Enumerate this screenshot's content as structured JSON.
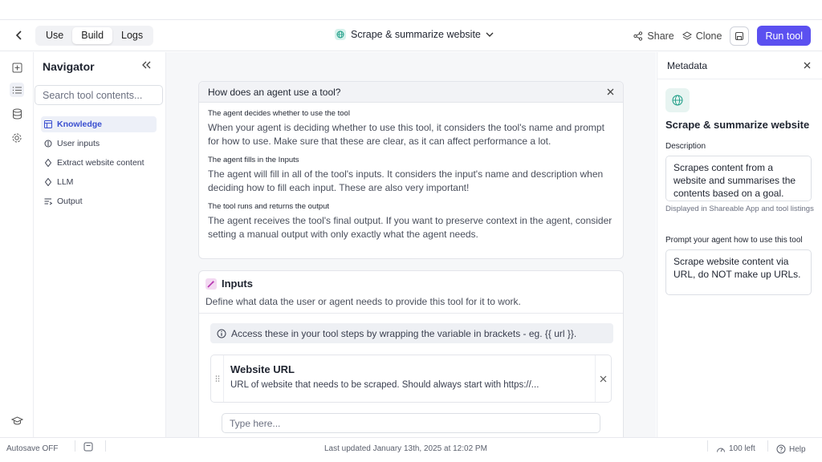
{
  "topbar": {
    "modes": [
      "Use",
      "Build",
      "Logs"
    ],
    "active_mode": "Build",
    "tool_title": "Scrape & summarize website",
    "share_label": "Share",
    "clone_label": "Clone",
    "run_label": "Run tool"
  },
  "navigator": {
    "title": "Navigator",
    "search_placeholder": "Search tool contents...",
    "items": [
      {
        "label": "Knowledge",
        "icon": "table-icon"
      },
      {
        "label": "User inputs",
        "icon": "input-icon"
      },
      {
        "label": "Extract website content",
        "icon": "diamond-icon"
      },
      {
        "label": "LLM",
        "icon": "diamond-icon"
      },
      {
        "label": "Output",
        "icon": "output-icon"
      }
    ]
  },
  "help": {
    "title": "How does an agent use a tool?",
    "sections": [
      {
        "heading": "The agent decides whether to use the tool",
        "text": "When your agent is deciding whether to use this tool, it considers the tool's name and prompt for how to use. Make sure that these are clear, as it can affect performance a lot."
      },
      {
        "heading": "The agent fills in the Inputs",
        "text": "The agent will fill in all of the tool's inputs. It considers the input's name and description when deciding how to fill each input. These are also very important!"
      },
      {
        "heading": "The tool runs and returns the output",
        "text": "The agent receives the tool's final output. If you want to preserve context in the agent, consider setting a manual output with only exactly what the agent needs."
      }
    ]
  },
  "inputs": {
    "title": "Inputs",
    "description": "Define what data the user or agent needs to provide this tool for it to work.",
    "info": "Access these in your tool steps by wrapping the variable in brackets - eg. {{ url }}.",
    "field": {
      "title": "Website URL",
      "description": "URL of website that needs to be scraped. Should always start with https://...",
      "placeholder": "Type here..."
    }
  },
  "metadata": {
    "title": "Metadata",
    "tool_name": "Scrape & summarize website",
    "description_label": "Description",
    "description_value": "Scrapes content from a website and summarises the contents based on a goal.",
    "description_hint": "Displayed in Shareable App and tool listings",
    "prompt_label": "Prompt your agent how to use this tool",
    "prompt_value": "Scrape website content via URL, do NOT make up URLs."
  },
  "status": {
    "autosave": "Autosave OFF",
    "last_updated": "Last updated January 13th, 2025 at 12:02 PM",
    "credits": "100 left",
    "help": "Help"
  },
  "colors": {
    "accent": "#5b50f0",
    "active_nav": "#3a4fd0"
  }
}
